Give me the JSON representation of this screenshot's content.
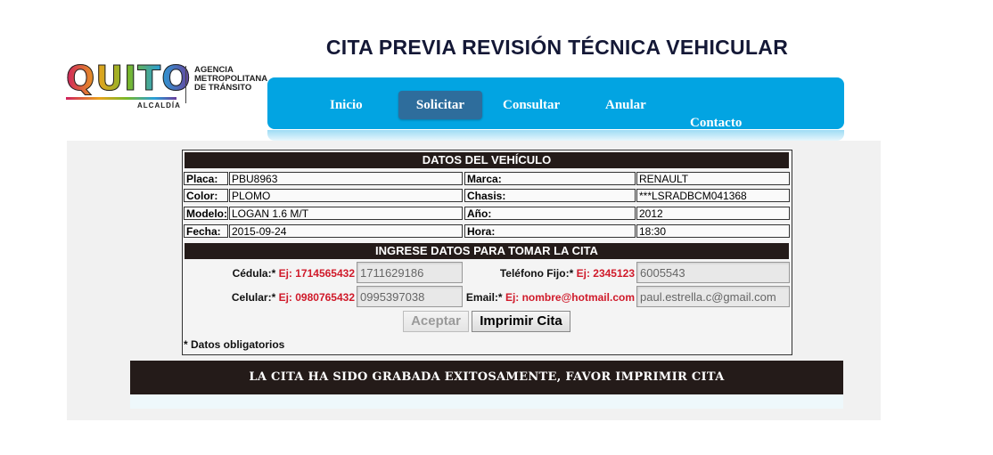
{
  "header": {
    "logo": {
      "brand": "QUITO",
      "sub": "ALCALDÍA",
      "agency_lines": [
        "AGENCIA",
        "METROPOLITANA",
        "DE TRÁNSITO"
      ]
    },
    "title": "CITA PREVIA REVISIÓN TÉCNICA VEHICULAR"
  },
  "nav": {
    "items": [
      {
        "label": "Inicio"
      },
      {
        "label": "Solicitar",
        "active": true
      },
      {
        "label": "Consultar"
      },
      {
        "label": "Anular"
      },
      {
        "label": "Contacto"
      }
    ],
    "colors": {
      "bar": "#02a4e2",
      "active": "#2e6d9c"
    }
  },
  "vehicle": {
    "heading": "DATOS DEL VEHÍCULO",
    "rows": [
      {
        "l1": "Placa:",
        "v1": "PBU8963",
        "l2": "Marca:",
        "v2": "RENAULT"
      },
      {
        "l1": "Color:",
        "v1": "PLOMO",
        "l2": "Chasis:",
        "v2": "***LSRADBCM041368"
      },
      {
        "l1": "Modelo:",
        "v1": "LOGAN 1.6 M/T",
        "l2": "Año:",
        "v2": "2012"
      },
      {
        "l1": "Fecha:",
        "v1": "2015-09-24",
        "l2": "Hora:",
        "v2": "18:30"
      }
    ]
  },
  "appointment": {
    "heading": "INGRESE DATOS PARA TOMAR LA CITA",
    "cedula": {
      "label": "Cédula:*",
      "example": "Ej: 1714565432",
      "value": "1711629186"
    },
    "telefono": {
      "label": "Teléfono Fijo:*",
      "example": "Ej: 2345123",
      "value": "6005543"
    },
    "celular": {
      "label": "Celular:*",
      "example": "Ej: 0980765432",
      "value": "0995397038"
    },
    "email": {
      "label": "Email:*",
      "example": "Ej: nombre@hotmail.com",
      "value": "paul.estrella.c@gmail.com"
    },
    "buttons": {
      "accept": "Aceptar",
      "print": "Imprimir Cita"
    },
    "required_note": "* Datos obligatorios"
  },
  "status": {
    "message": "LA CITA HA SIDO GRABADA EXITOSAMENTE, FAVOR IMPRIMIR CITA",
    "example_color": "#d01a2a",
    "bar_color": "#241b19"
  }
}
